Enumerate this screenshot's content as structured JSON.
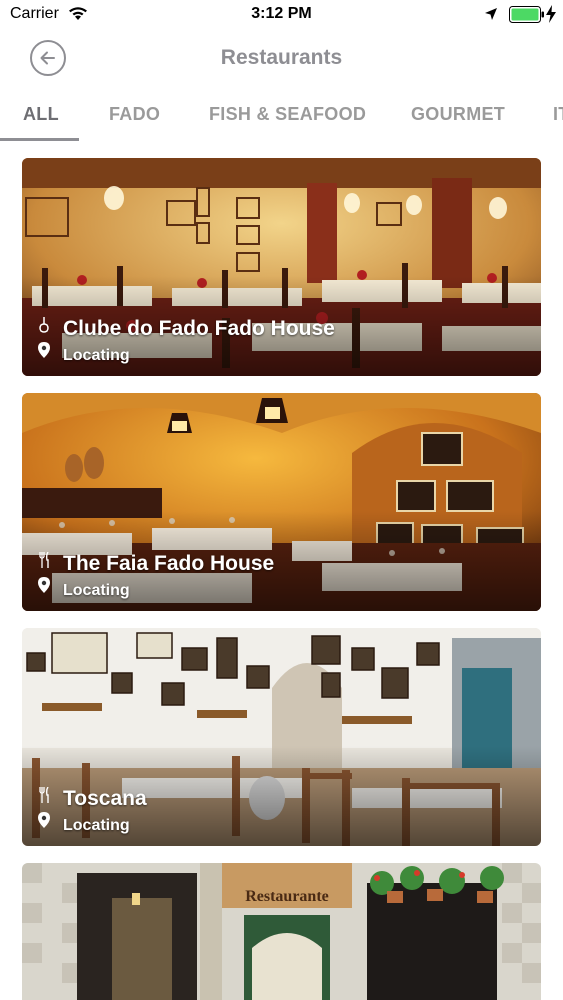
{
  "status_bar": {
    "carrier": "Carrier",
    "time": "3:12 PM"
  },
  "nav": {
    "title": "Restaurants"
  },
  "tabs": [
    {
      "label": "ALL"
    },
    {
      "label": "FADO"
    },
    {
      "label": "FISH & SEAFOOD"
    },
    {
      "label": "GOURMET"
    },
    {
      "label": "IT"
    }
  ],
  "restaurants": [
    {
      "name": "Clube do Fado Fado House",
      "location": "Locating",
      "category_icon": "guitar-icon"
    },
    {
      "name": "The Faia Fado House",
      "location": "Locating",
      "category_icon": "fork-knife-icon"
    },
    {
      "name": "Toscana",
      "location": "Locating",
      "category_icon": "fork-knife-icon"
    },
    {
      "sign_text": "Restaurante"
    }
  ],
  "colors": {
    "accent": "#8e8e93",
    "battery": "#4cd964"
  }
}
